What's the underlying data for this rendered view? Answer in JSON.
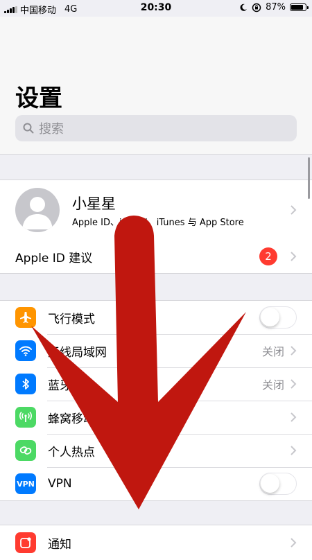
{
  "status_bar": {
    "carrier": "中国移动",
    "network": "4G",
    "time": "20:30",
    "battery": "87%",
    "battery_level": 0.87,
    "icons": [
      "moon-icon",
      "orientation-lock-icon"
    ]
  },
  "header": {
    "title": "设置",
    "search_placeholder": "搜索"
  },
  "profile": {
    "name": "小星星",
    "subtitle": "Apple ID、iCloud、iTunes 与 App Store",
    "suggestion_label": "Apple ID 建议",
    "suggestion_badge": "2"
  },
  "connectivity": [
    {
      "label": "飞行模式",
      "icon": "airplane-icon",
      "color": "#ff9500",
      "control": "toggle",
      "on": false
    },
    {
      "label": "无线局域网",
      "icon": "wifi-icon",
      "color": "#007aff",
      "value": "关闭",
      "control": "chevron"
    },
    {
      "label": "蓝牙",
      "icon": "bluetooth-icon",
      "color": "#007aff",
      "value": "关闭",
      "control": "chevron"
    },
    {
      "label": "蜂窝移动网络",
      "icon": "cellular-icon",
      "color": "#4cd964",
      "control": "chevron"
    },
    {
      "label": "个人热点",
      "icon": "hotspot-icon",
      "color": "#4cd964",
      "control": "chevron"
    },
    {
      "label": "VPN",
      "icon": "vpn-icon",
      "icon_text": "VPN",
      "color": "#007aff",
      "control": "toggle",
      "on": false
    }
  ],
  "notifications": {
    "label": "通知",
    "icon": "notifications-icon",
    "color": "#ff3b30"
  },
  "overlay": {
    "icon": "red-down-arrow-icon",
    "color": "#c0170f"
  }
}
